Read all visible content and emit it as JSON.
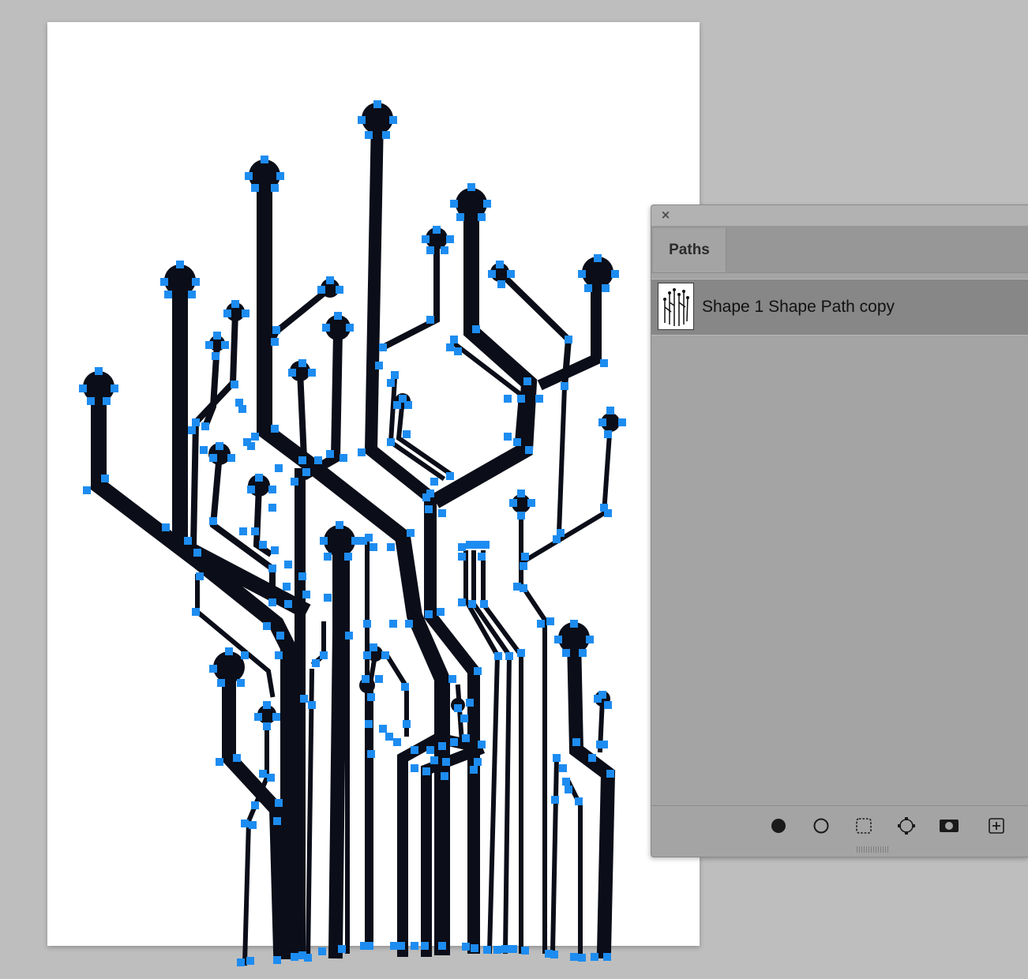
{
  "panel": {
    "close_glyph": "×",
    "tab_label": "Paths",
    "path_items": [
      {
        "name": "Shape 1 Shape Path copy"
      }
    ],
    "footer_buttons": [
      {
        "icon": "fill-path-icon"
      },
      {
        "icon": "stroke-path-icon"
      },
      {
        "icon": "load-selection-icon"
      },
      {
        "icon": "make-work-path-icon"
      },
      {
        "icon": "add-mask-icon"
      },
      {
        "icon": "new-path-icon"
      }
    ]
  },
  "colors": {
    "trace": "#0b0d18",
    "anchor": "#1d8cf0",
    "canvas": "#ffffff",
    "workspace": "#bebebe"
  }
}
